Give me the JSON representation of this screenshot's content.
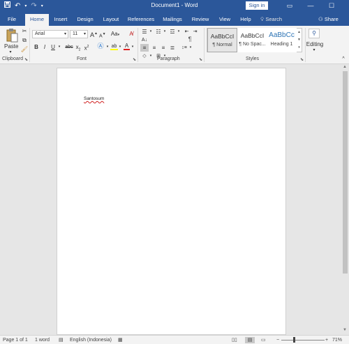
{
  "titlebar": {
    "doc_title": "Document1 - Word",
    "signin_label": "Sign in",
    "qat_icons": [
      "save-icon",
      "undo-icon",
      "redo-icon",
      "customize-qat-icon"
    ],
    "window_buttons": [
      "ribbon-display-icon",
      "minimize-icon",
      "maximize-icon",
      "close-icon"
    ]
  },
  "tabs": [
    "File",
    "Home",
    "Insert",
    "Design",
    "Layout",
    "References",
    "Mailings",
    "Review",
    "View",
    "Help"
  ],
  "active_tab": "Home",
  "tellme": {
    "placeholder": "Search"
  },
  "share_label": "Share",
  "ribbon": {
    "clipboard": {
      "paste_label": "Paste",
      "group_label": "Clipboard"
    },
    "font": {
      "font_name": "Arial",
      "font_size": "11",
      "grow_label": "A",
      "shrink_label": "A",
      "case_label": "Aa",
      "bold": "B",
      "italic": "I",
      "underline": "U",
      "strike": "abc",
      "subscript": "x",
      "superscript": "x",
      "font_color": "A",
      "group_label": "Font"
    },
    "paragraph": {
      "group_label": "Paragraph",
      "pilcrow": "¶"
    },
    "styles": {
      "items": [
        {
          "sample": "AaBbCcI",
          "name": "¶ Normal"
        },
        {
          "sample": "AaBbCcI",
          "name": "¶ No Spac..."
        },
        {
          "sample": "AaBbCc",
          "name": "Heading 1"
        }
      ],
      "group_label": "Styles"
    },
    "editing": {
      "label": "Editing"
    }
  },
  "document": {
    "text": "Santosum"
  },
  "statusbar": {
    "page": "Page 1 of 1",
    "words": "1 word",
    "language": "English (Indonesia)",
    "zoom": "71%",
    "zoom_minus": "−",
    "zoom_plus": "+"
  },
  "colors": {
    "title_blue": "#2b579a",
    "ribbon_bg": "#f3f3f3",
    "canvas_bg": "#e6e6e6",
    "highlight_yellow": "#ffff00",
    "font_color_red": "#e02020",
    "heading_blue": "#2e74b5"
  }
}
